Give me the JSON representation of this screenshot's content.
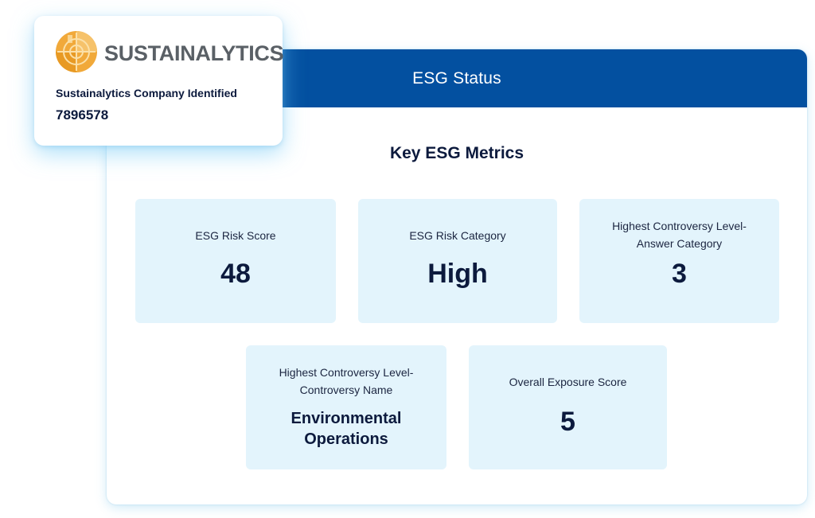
{
  "panel": {
    "header_title": "ESG Status",
    "metrics_title": "Key ESG Metrics"
  },
  "metrics": [
    {
      "label_line1": "ESG Risk Score",
      "label_line2": "",
      "value": "48"
    },
    {
      "label_line1": "ESG Risk Category",
      "label_line2": "",
      "value": "High"
    },
    {
      "label_line1": "Highest Controversy Level-",
      "label_line2": "Answer Category",
      "value": "3"
    },
    {
      "label_line1": "Highest Controversy Level-",
      "label_line2": "Controversy Name",
      "value_line1": "Environmental",
      "value_line2": "Operations"
    },
    {
      "label_line1": "Overall Exposure Score",
      "label_line2": "",
      "value": "5"
    }
  ],
  "company": {
    "brand": "SUSTAINALYTICS",
    "label": "Sustainalytics Company Identified",
    "id": "7896578"
  },
  "colors": {
    "header_bg": "#0350a0",
    "card_bg": "#e3f4fc",
    "text_dark": "#0c1a3d",
    "logo_orange": "#f1a93a",
    "logo_gray": "#5a6066"
  },
  "icons": {
    "brand_logo": "sustainalytics-target-icon"
  }
}
